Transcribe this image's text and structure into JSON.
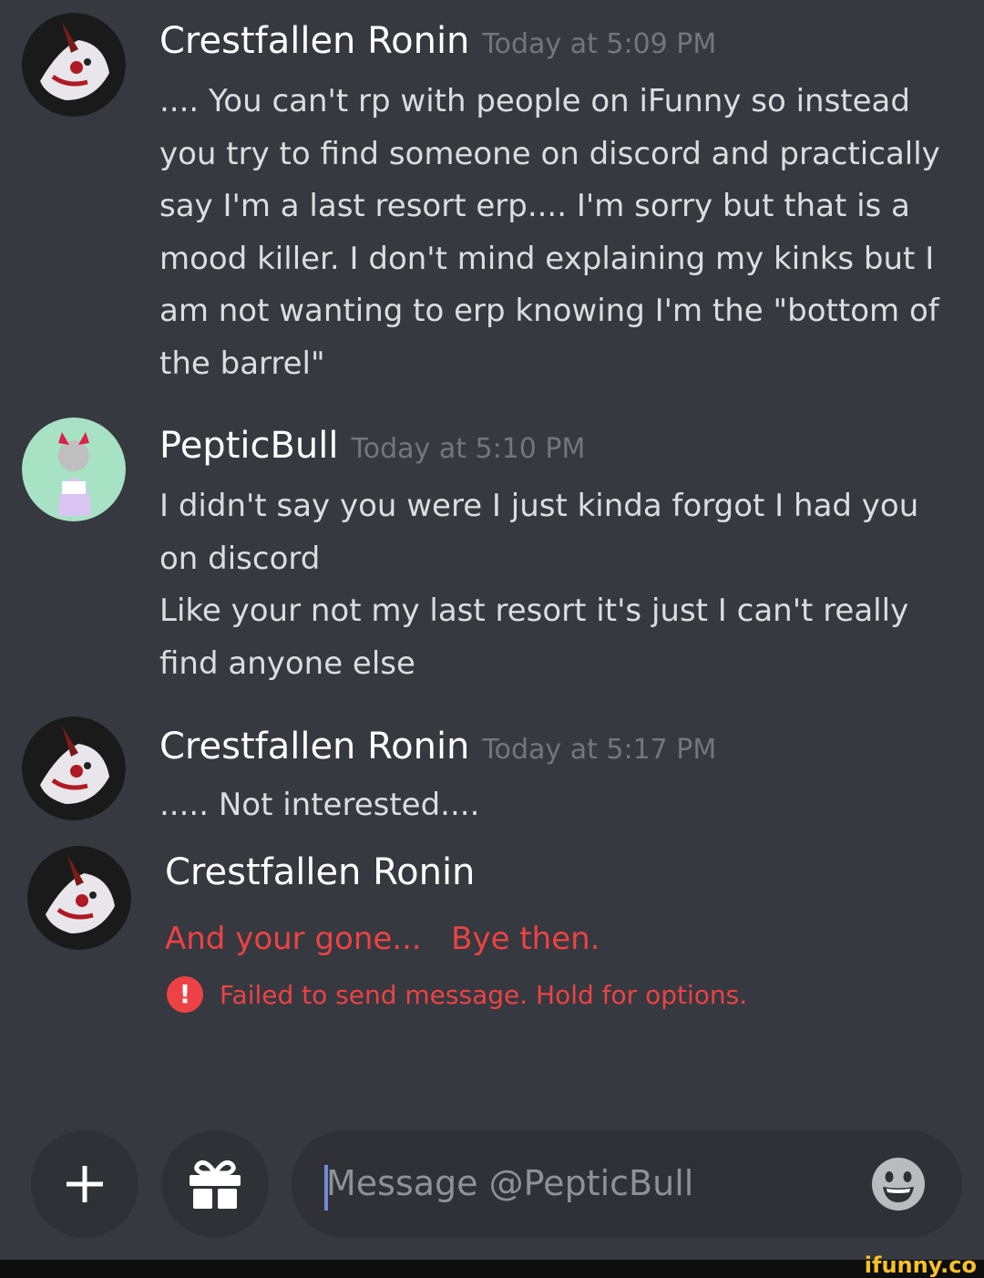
{
  "messages": [
    {
      "author": "Crestfallen Ronin",
      "timestamp": "Today at 5:09 PM",
      "avatar_icon": "ronin-avatar-icon",
      "lines": [
        ".... You can't rp with people on iFunny so instead",
        "you try to find someone on discord and practically",
        "say I'm a last resort erp.... I'm sorry but that is a",
        "mood killer.  I don't mind explaining my kinks but I",
        "am not wanting to erp knowing I'm the \"bottom of",
        "the barrel\""
      ]
    },
    {
      "author": "PepticBull",
      "timestamp": "Today at 5:10 PM",
      "avatar_icon": "pepticbull-avatar-icon",
      "lines": [
        "I didn't say you were I just kinda forgot I had you",
        "on discord",
        "Like your not my last resort it's just I can't really",
        "find anyone else"
      ]
    },
    {
      "author": "Crestfallen Ronin",
      "timestamp": "Today at 5:17 PM",
      "avatar_icon": "ronin-avatar-icon",
      "lines": [
        "..... Not interested...."
      ]
    },
    {
      "author": "Crestfallen Ronin",
      "timestamp": "",
      "avatar_icon": "ronin-avatar-icon",
      "failed": true,
      "lines": [
        "And your gone...   Bye then."
      ],
      "error": "Failed to send message. Hold for options.",
      "error_icon": "exclamation-icon"
    }
  ],
  "composer": {
    "add_icon": "plus-icon",
    "gift_icon": "gift-icon",
    "placeholder": "Message @PepticBull",
    "emoji_icon": "smiley-emoji-icon"
  },
  "watermark": "ifunny.co",
  "colors": {
    "background": "#36393f",
    "username": "#ffffff",
    "timestamp": "#72767d",
    "message_text": "#dcddde",
    "error": "#ed4245",
    "input_bg": "#2f3136",
    "caret": "#7289da",
    "watermark": "#f7c227"
  }
}
